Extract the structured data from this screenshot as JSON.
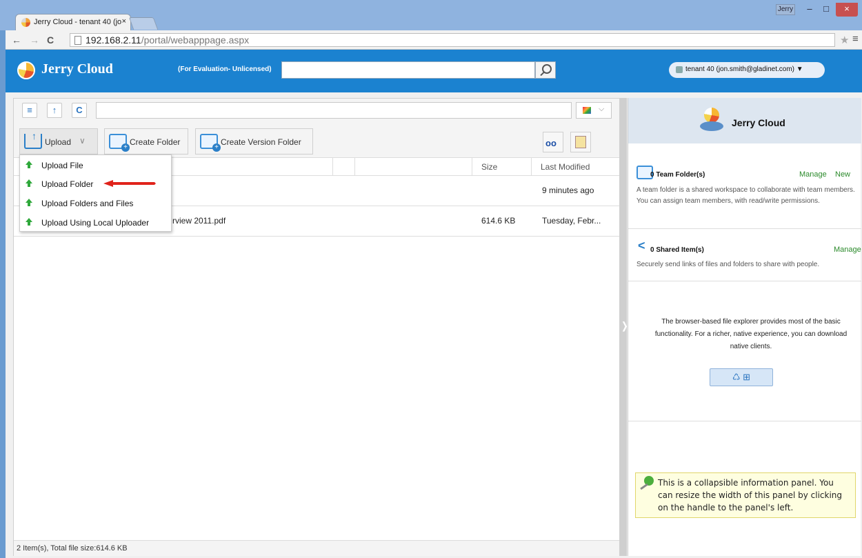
{
  "browser": {
    "tab_title": "Jerry Cloud - tenant 40 (jo",
    "tab_close": "×",
    "window_user": "Jerry",
    "win_minimize": "–",
    "win_maximize": "□",
    "win_close": "×",
    "url_host": "192.168.2.11",
    "url_path": "/portal/webapppage.aspx",
    "back": "←",
    "forward": "→",
    "reload": "C",
    "star": "★",
    "menu": "≡"
  },
  "app": {
    "name": "Jerry Cloud",
    "eval_notice": "(For Evaluation- Unlicensed)",
    "search_placeholder": "",
    "user_pill": "tenant 40  (jon.smith@gladinet.com) ▼",
    "brand_color": "#1b82d0"
  },
  "toolbar": {
    "list_icon": "≡",
    "up_icon": "↑",
    "refresh_icon": "C",
    "view_chevron": "⌵",
    "upload_label": "Upload",
    "upload_chevron": "∨",
    "create_folder_label": "Create Folder",
    "create_version_folder_label": "Create Version Folder",
    "glasses_icon": "oo"
  },
  "upload_menu": {
    "items": [
      "Upload File",
      "Upload Folder",
      "Upload Folders and Files",
      "Upload Using Local Uploader"
    ],
    "highlighted": "Upload Folder"
  },
  "file_table": {
    "columns": [
      "Size",
      "Last Modified"
    ],
    "rows": [
      {
        "name": "",
        "size": "",
        "modified": "9 minutes ago"
      },
      {
        "name": "rview 2011.pdf",
        "size": "614.6 KB",
        "modified": "Tuesday, Febr..."
      }
    ]
  },
  "status_bar": "2 Item(s), Total file size:614.6 KB",
  "right_panel": {
    "title": "Jerry Cloud",
    "team": {
      "title": "0 Team Folder(s)",
      "manage": "Manage",
      "new": "New",
      "desc": "A team folder is a shared workspace to collaborate with team members. You can assign team members, with read/write permissions."
    },
    "shared": {
      "title": "0 Shared Item(s)",
      "manage": "Manage",
      "desc": "Securely send links of files and folders to share with people."
    },
    "body": "The browser-based file explorer provides most of the basic functionality. For a richer, native experience, you can download native clients.",
    "clients_icons": "♺ ⊞  ",
    "tip": "This is a collapsible information panel. You can resize the width of this panel by clicking on the handle to the panel's left.",
    "grip": "❭"
  }
}
